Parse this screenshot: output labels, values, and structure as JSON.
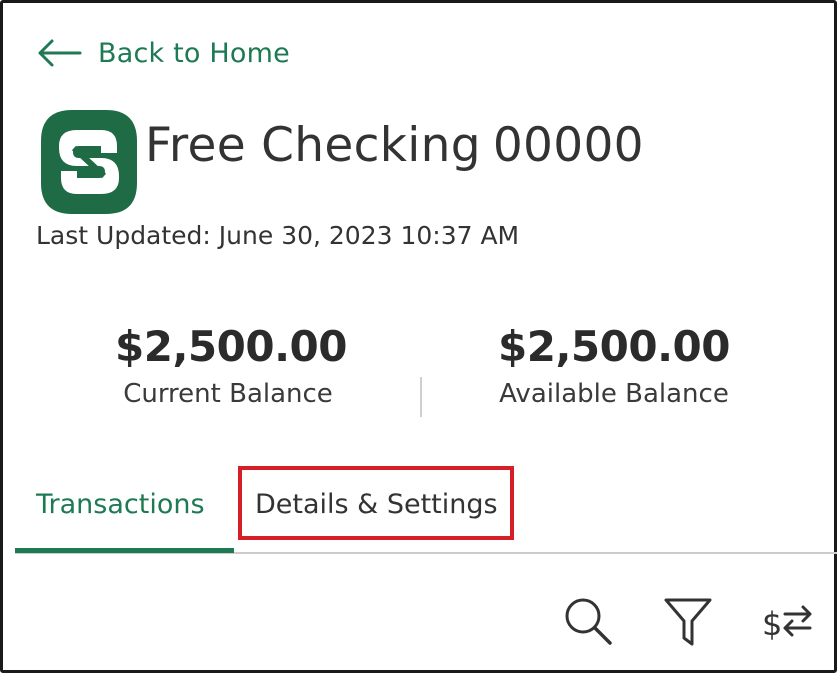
{
  "back": {
    "label": "Back to Home",
    "icon": "arrow-left-icon"
  },
  "account": {
    "logo": "bank-logo",
    "name": "Free Checking",
    "number": "00000",
    "last_updated": "Last Updated: June 30, 2023 10:37 AM"
  },
  "balances": {
    "current": {
      "amount": "$2,500.00",
      "label": "Current Balance"
    },
    "available": {
      "amount": "$2,500.00",
      "label": "Available Balance"
    }
  },
  "tabs": [
    {
      "label": "Transactions",
      "active": true
    },
    {
      "label": "Details & Settings",
      "active": false,
      "highlighted": true
    }
  ],
  "toolbar": {
    "icons": [
      "search-icon",
      "filter-icon",
      "sort-icon"
    ]
  },
  "colors": {
    "brand_green": "#1e7a52",
    "logo_green": "#1f6b45",
    "highlight_red": "#d61f26",
    "text": "#333333"
  }
}
